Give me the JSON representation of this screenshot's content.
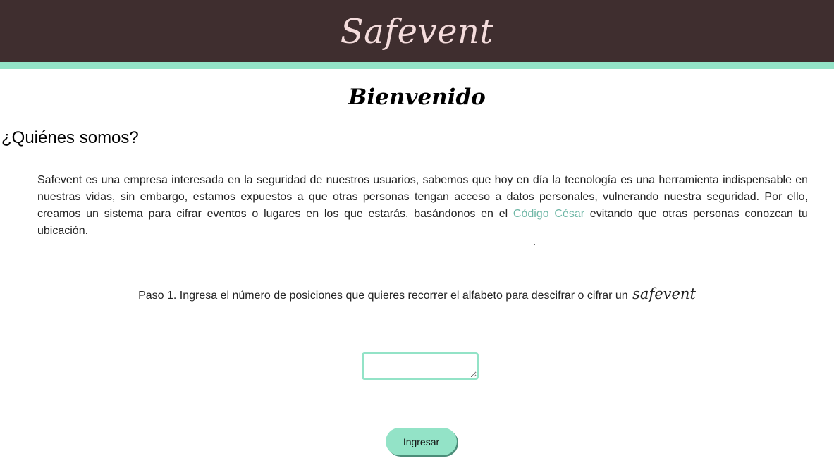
{
  "header": {
    "brand": "Safevent"
  },
  "main": {
    "welcome": "Bienvenido",
    "about_heading": "¿Quiénes somos?",
    "about_text_before": "Safevent es una empresa interesada en la seguridad de nuestros usuarios, sabemos que hoy en día la tecnología es una herramienta indispensable en nuestras vidas, sin embargo, estamos expuestos a que otras personas tengan acceso a datos personales, vulnerando nuestra seguridad. Por ello, creamos un sistema para cifrar eventos o lugares en los que estarás, basándonos en el ",
    "about_link": "Código César",
    "about_text_after": " evitando que otras personas conozcan tu ubicación.",
    "dot": ".",
    "step_text": "Paso 1. Ingresa el número de posiciones que quieres recorrer el alfabeto para descifrar o cifrar un ",
    "step_script": "safevent",
    "input_value": "",
    "submit_label": "Ingresar"
  },
  "colors": {
    "header_bg": "#3f2e2f",
    "brand_text": "#f4dcdc",
    "accent_mint": "#93e3c7",
    "link": "#6fb7a6"
  }
}
